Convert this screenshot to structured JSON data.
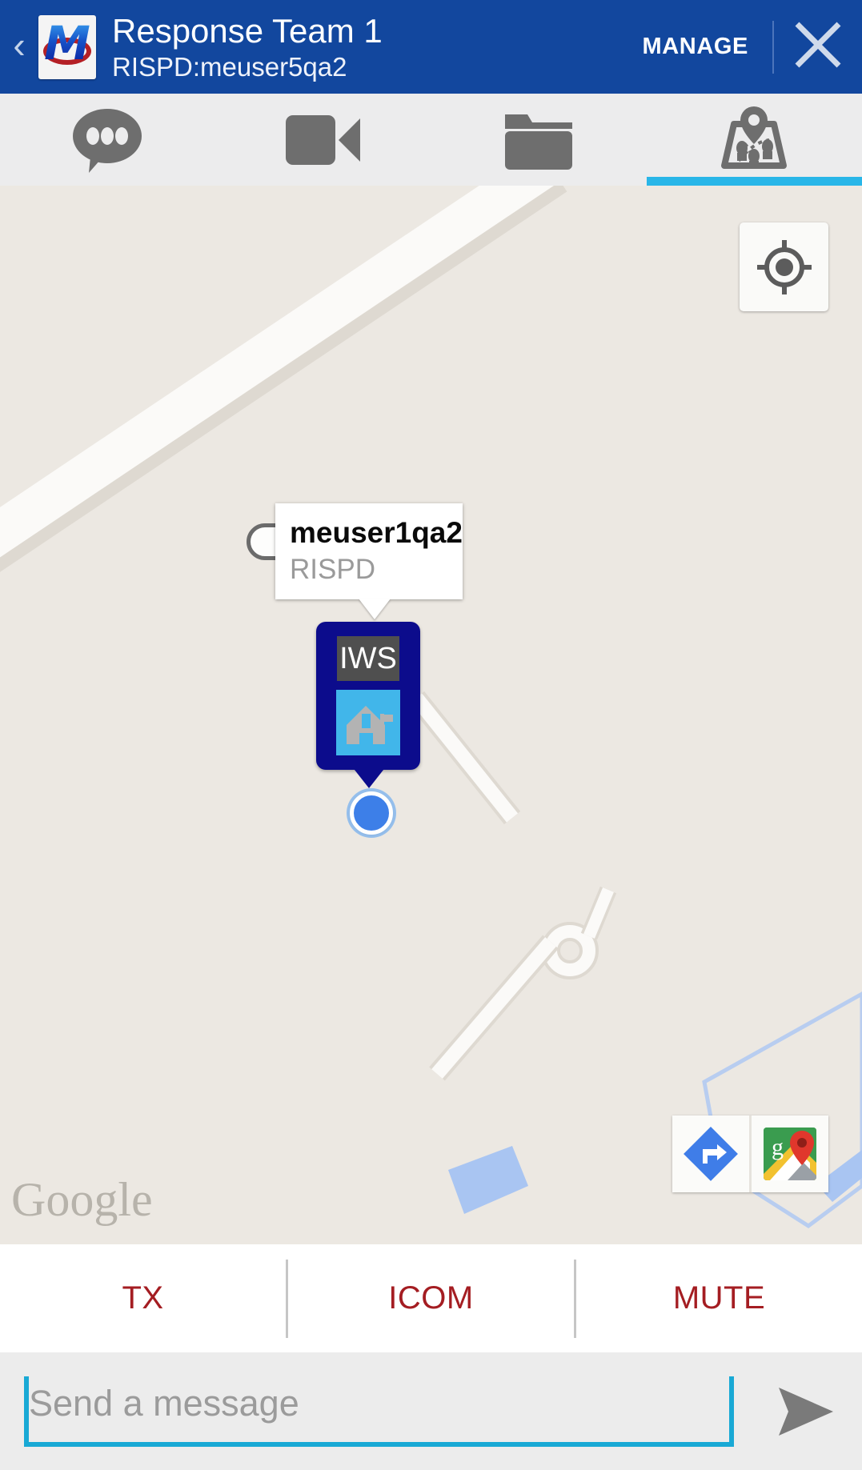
{
  "header": {
    "back_icon": "back-chevron-icon",
    "logo_icon": "app-logo-icon",
    "logo_letter": "M",
    "title": "Response Team 1",
    "subtitle": "RISPD:meuser5qa2",
    "manage_label": "MANAGE",
    "close_icon": "close-icon",
    "bg_color": "#12479e"
  },
  "tabs": [
    {
      "name": "chat",
      "icon": "chat-bubble-icon",
      "active": false
    },
    {
      "name": "video",
      "icon": "video-camera-icon",
      "active": false
    },
    {
      "name": "files",
      "icon": "folder-icon",
      "active": false
    },
    {
      "name": "map",
      "icon": "map-pin-people-icon",
      "active": true
    }
  ],
  "tab_active_color": "#29b6e8",
  "map": {
    "background_color": "#ece8e2",
    "my_location_icon": "my-location-crosshair-icon",
    "watermark": "Google",
    "callout": {
      "title": "meuser1qa2",
      "subtitle": "RISPD"
    },
    "marker": {
      "label": "IWS",
      "icon": "building-with-flag-icon",
      "body_color": "#0c0c8c",
      "label_bg_color": "#4f4f4f",
      "icon_bg_color": "#41b6ea"
    },
    "location_dot": {
      "icon": "current-location-dot-icon",
      "color": "#3d7fe8"
    },
    "bottom_buttons": [
      {
        "name": "directions",
        "icon": "directions-arrow-icon"
      },
      {
        "name": "google-maps",
        "icon": "google-maps-logo-icon"
      }
    ]
  },
  "action_bar": {
    "items": [
      {
        "label": "TX"
      },
      {
        "label": "ICOM"
      },
      {
        "label": "MUTE"
      }
    ],
    "text_color": "#a41d22"
  },
  "message_bar": {
    "placeholder": "Send a message",
    "value": "",
    "send_icon": "send-arrow-icon",
    "underline_color": "#19a9d5"
  }
}
